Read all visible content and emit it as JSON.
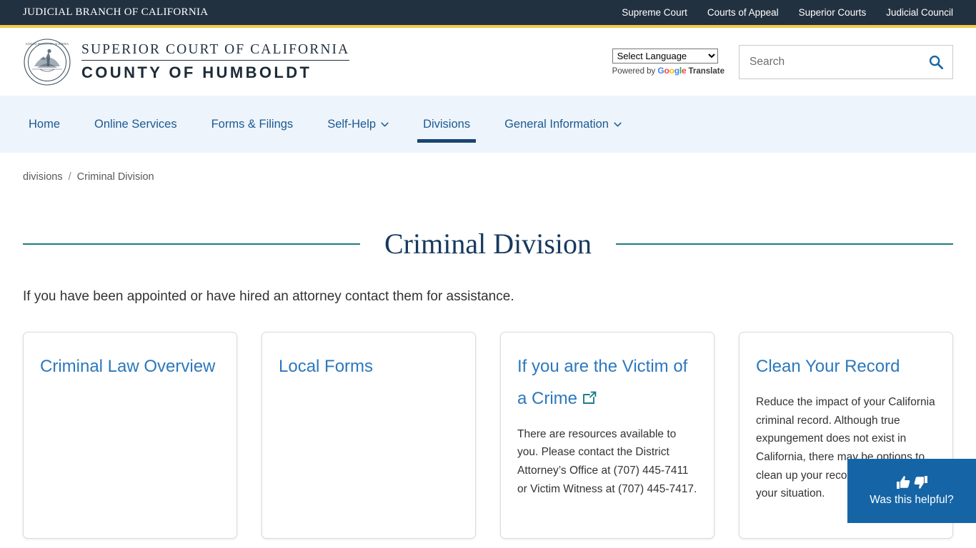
{
  "topbar": {
    "brand": "JUDICIAL BRANCH OF CALIFORNIA",
    "links": [
      {
        "label": "Supreme Court"
      },
      {
        "label": "Courts of Appeal"
      },
      {
        "label": "Superior Courts"
      },
      {
        "label": "Judicial Council"
      }
    ],
    "background_color": "#223140",
    "accent_rule_color": "#f0c94b"
  },
  "masthead": {
    "seal_alt": "judicial-branch-of-california-seal",
    "wordmark_line1": "SUPERIOR COURT OF CALIFORNIA",
    "wordmark_line2": "COUNTY OF HUMBOLDT",
    "translate": {
      "selected_option": "Select Language",
      "options": [
        "Select Language"
      ],
      "powered_by_prefix": "Powered by",
      "google_letters": [
        "G",
        "o",
        "o",
        "g",
        "l",
        "e"
      ],
      "translate_word": "Translate"
    },
    "search": {
      "placeholder": "Search",
      "value": "",
      "icon": "search-icon"
    }
  },
  "mainnav": {
    "background_color": "#eef4fb",
    "active_underline_color": "#184571",
    "items": [
      {
        "label": "Home",
        "has_caret": false,
        "active": false
      },
      {
        "label": "Online Services",
        "has_caret": false,
        "active": false
      },
      {
        "label": "Forms & Filings",
        "has_caret": false,
        "active": false
      },
      {
        "label": "Self-Help",
        "has_caret": true,
        "active": false
      },
      {
        "label": "Divisions",
        "has_caret": false,
        "active": true
      },
      {
        "label": "General Information",
        "has_caret": true,
        "active": false
      }
    ]
  },
  "breadcrumb": {
    "parent": "divisions",
    "separator": "/",
    "current": "Criminal Division"
  },
  "main": {
    "title": "Criminal Division",
    "title_rule_color": "#1d7b8a",
    "intro": "If you have been appointed or have hired an attorney contact them for assistance.",
    "link_color": "#2c78bd",
    "cards": [
      {
        "title": "Criminal Law Overview",
        "body": "",
        "external": false
      },
      {
        "title": "Local Forms",
        "body": "",
        "external": false
      },
      {
        "title": "If you are the Victim of a Crime",
        "body": "There are resources available to you. Please contact the District Attorney’s Office at (707) 445-7411 or Victim Witness at (707) 445-7417.",
        "external": true
      },
      {
        "title": "Clean Your Record",
        "body": "Reduce the impact of your California criminal record. Although true expungement does not exist in California, there may be options to clean up your record depending on your situation.",
        "external": false
      }
    ]
  },
  "feedback": {
    "label": "Was this helpful?",
    "thumbs_up_icon": "thumbs-up-icon",
    "thumbs_down_icon": "thumbs-down-icon",
    "background_color": "#1565a6"
  }
}
